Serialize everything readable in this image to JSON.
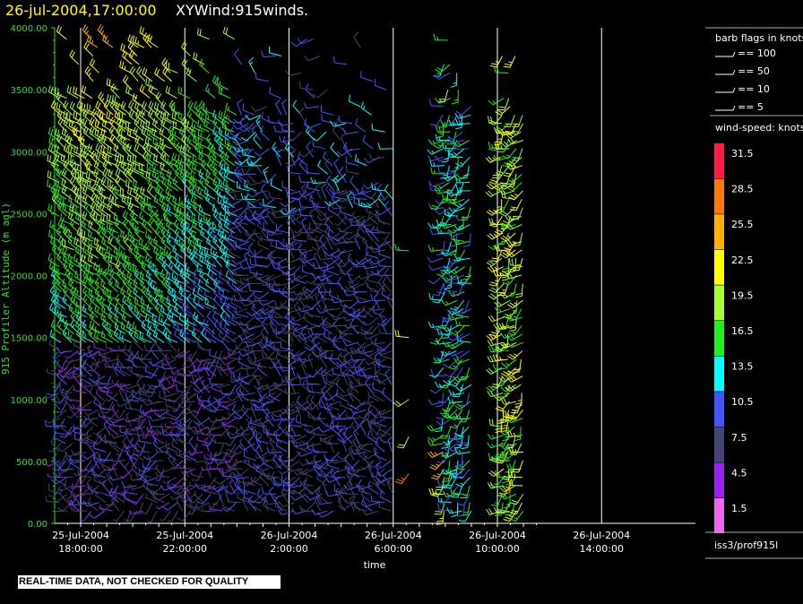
{
  "header": {
    "datetime": "26-jul-2004,17:00:00",
    "product": "XYWind:915winds."
  },
  "chart_data": {
    "type": "wind-barb",
    "title": "26-jul-2004,17:00:00  XYWind:915winds.",
    "xlabel": "time",
    "ylabel": "915 Profiler Altitude (m agl)",
    "x_ticks": [
      {
        "date": "25-Jul-2004",
        "time": "18:00:00"
      },
      {
        "date": "25-Jul-2004",
        "time": "22:00:00"
      },
      {
        "date": "26-Jul-2004",
        "time": "2:00:00"
      },
      {
        "date": "26-Jul-2004",
        "time": "6:00:00"
      },
      {
        "date": "26-Jul-2004",
        "time": "10:00:00"
      },
      {
        "date": "26-Jul-2004",
        "time": "14:00:00"
      }
    ],
    "xlim_hours_from_tick1": [
      -1,
      17.7
    ],
    "y_ticks": [
      "4000.00",
      "3500.00",
      "3000.00",
      "2500.00",
      "2000.00",
      "1500.00",
      "1000.00",
      "500.00",
      "0.00"
    ],
    "ylim": [
      0,
      4000
    ],
    "vertical_gridlines": true,
    "barb_flags_legend": {
      "title": "barb flags in knots",
      "items": [
        "== 100",
        "== 50",
        "== 10",
        "== 5"
      ]
    },
    "speed_legend": {
      "title": "wind-speed: knots",
      "bins": [
        {
          "label": "31.5",
          "color": "#ff1a4a"
        },
        {
          "label": "28.5",
          "color": "#ff7a00"
        },
        {
          "label": "25.5",
          "color": "#ffb300"
        },
        {
          "label": "22.5",
          "color": "#ffff00"
        },
        {
          "label": "19.5",
          "color": "#aaff33"
        },
        {
          "label": "16.5",
          "color": "#22ee22"
        },
        {
          "label": "13.5",
          "color": "#00ffff"
        },
        {
          "label": "10.5",
          "color": "#4455ff"
        },
        {
          "label": "7.5",
          "color": "#444477"
        },
        {
          "label": "4.5",
          "color": "#9922ee"
        },
        {
          "label": "1.5",
          "color": "#ee66ee"
        }
      ]
    },
    "gaps_hours_from_tick1": [
      [
        12.1,
        13.9
      ],
      [
        15.0,
        16.0
      ],
      [
        17.0,
        17.8
      ],
      [
        18.9,
        19.7
      ]
    ]
  },
  "station": "iss3/prof915l",
  "banner": "REAL-TIME DATA, NOT CHECKED FOR QUALITY",
  "colors": {
    "axis": "#33dd33",
    "grid": "#ffffff",
    "title_date": "#ffff00"
  }
}
